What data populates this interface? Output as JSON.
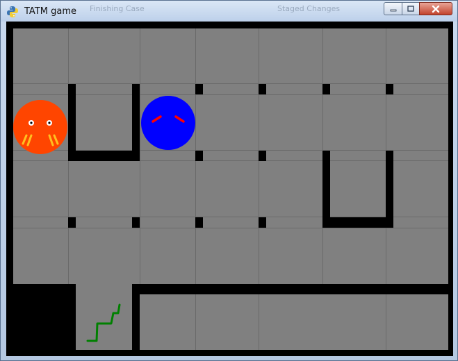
{
  "window": {
    "title": "TATM game",
    "ghost_texts": [
      "Finishing Case",
      "Staged Changes"
    ]
  },
  "game": {
    "columns": 7,
    "rows": 5,
    "colors": {
      "floor": "#808080",
      "wall": "#000000",
      "grid_line": "#6a6a6a",
      "enemy_body": "#ff4500",
      "enemy_horns": "#d40000",
      "enemy_fangs": "#ffc020",
      "player_body": "#0000ff",
      "player_brows": "#ff0000",
      "squiggle": "#008000"
    },
    "sprites": [
      {
        "name": "devil-enemy",
        "col": 0,
        "row": 1
      },
      {
        "name": "blue-ball-player",
        "col": 2,
        "row": 1
      },
      {
        "name": "green-squiggle",
        "col": 1,
        "row": 4
      }
    ]
  }
}
